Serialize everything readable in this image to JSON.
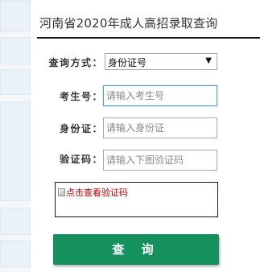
{
  "header": {
    "title": "河南省2020年成人高招录取查询"
  },
  "form": {
    "method": {
      "label": "查询方式：",
      "selected": "身份证号"
    },
    "exam_number": {
      "label": "考生号：",
      "placeholder": "请输入考生号"
    },
    "id_card": {
      "label": "身份证：",
      "placeholder": "请输入身份证"
    },
    "captcha": {
      "label": "验证码：",
      "placeholder": "请输入下图验证码",
      "image_text": "点击查看验证码"
    },
    "submit_label": "查 询"
  },
  "colors": {
    "accent": "#14915e",
    "focus_border": "#5b9bd5",
    "captcha_text": "#cc0000"
  }
}
